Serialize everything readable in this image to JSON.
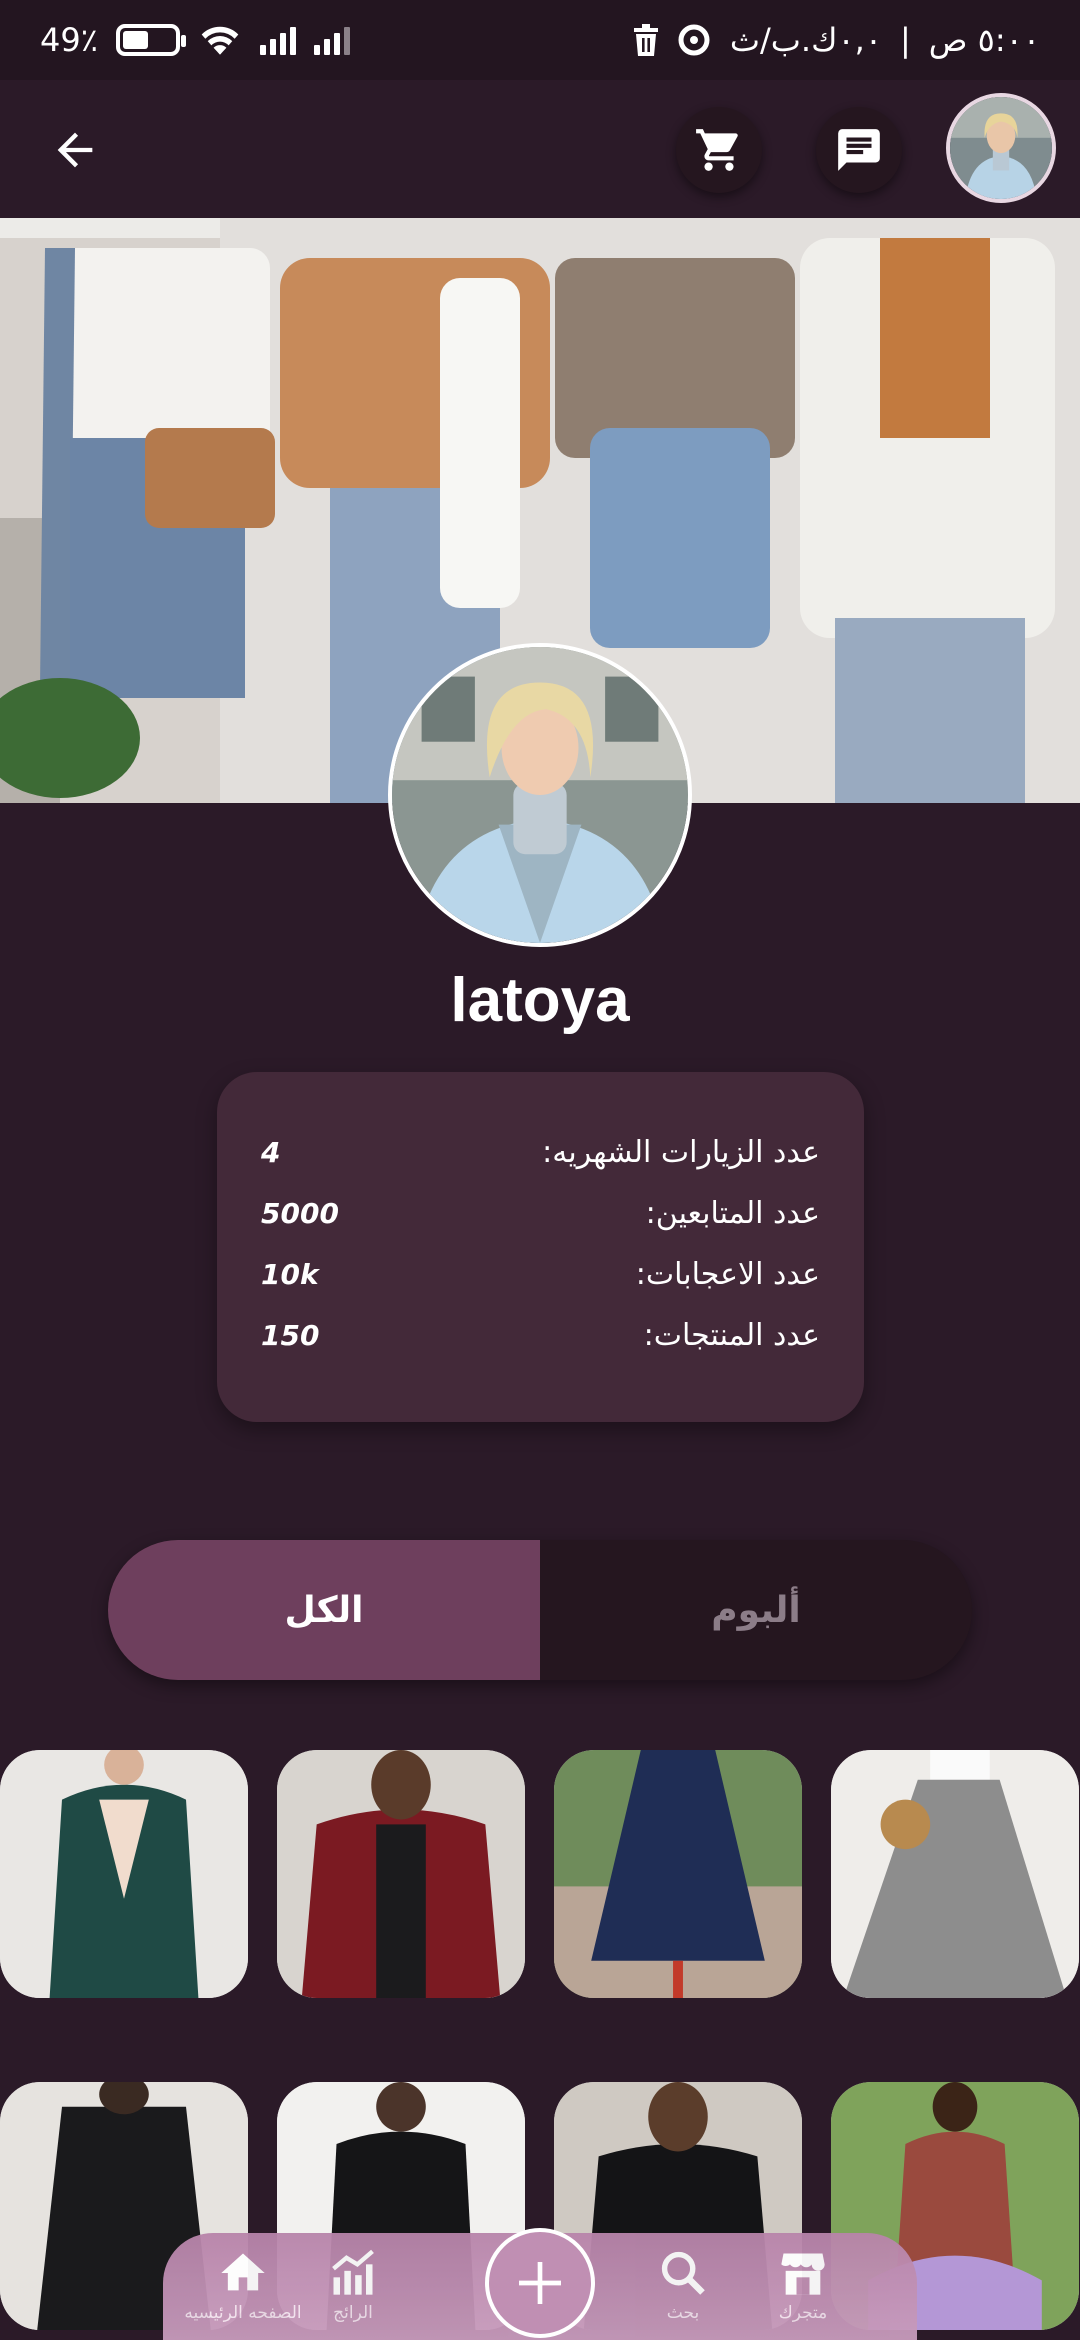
{
  "status_bar": {
    "time": "٥:٠٠ ص",
    "data_speed": "٠,٠ك.ب/ث",
    "battery_text": "49٪",
    "battery_level": 0.49
  },
  "app_bar": {
    "back_icon": "arrow-back-icon",
    "cart_icon": "cart-icon",
    "chat_icon": "chat-icon"
  },
  "profile": {
    "username": "latoya"
  },
  "stats": [
    {
      "label": "عدد الزيارات الشهريه:",
      "value": "4"
    },
    {
      "label": "عدد المتابعين:",
      "value": "5000"
    },
    {
      "label": "عدد الاعجابات:",
      "value": "10k"
    },
    {
      "label": "عدد المنتجات:",
      "value": "150"
    }
  ],
  "tabs": {
    "all": "الكل",
    "album": "ألبوم"
  },
  "bottom_nav": {
    "home": "الصفحه الرئيسيه",
    "trending": "الرائج",
    "search": "بحث",
    "store": "متجرك"
  },
  "colors": {
    "background": "#2b1a28",
    "card": "#432939",
    "tab_active": "#6e3f5d",
    "nav": "#c08fb3"
  }
}
